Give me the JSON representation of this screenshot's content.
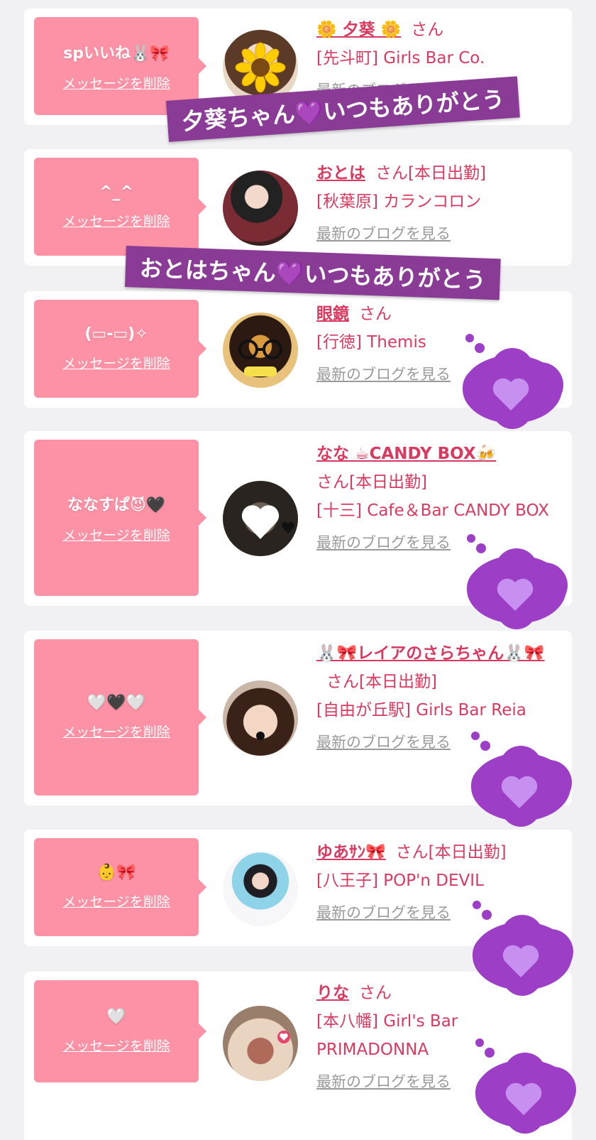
{
  "delete_label": "メッセージを削除",
  "san_label": "さん",
  "blog_label": "最新のブログを見る",
  "colors": {
    "bubble": "#fd92a6",
    "name": "#d83a60",
    "banner": "#8a3b96",
    "thought_cloud": "#9d3fc6",
    "heart": "#c78ff0"
  },
  "banners": [
    {
      "text": "夕葵ちゃん💜いつもありがとう"
    },
    {
      "text": "おとはちゃん💜いつもありがとう"
    }
  ],
  "items": [
    {
      "message": "spいいね🐰🎀",
      "name": "🌼 夕葵 🌼",
      "status": "",
      "shop": "[先斗町] Girls Bar Co.",
      "avatar_icon": "sunflower-sticker-icon"
    },
    {
      "message": "^_^",
      "name": "おとは",
      "status": "[本日出勤]",
      "shop": "[秋葉原] カランコロン",
      "avatar_icon": "portrait-photo-icon"
    },
    {
      "message": "(▭-▭)✧",
      "name": "眼鏡",
      "status": "",
      "shop": "[行徳] Themis",
      "avatar_icon": "glasses-photo-icon"
    },
    {
      "message": "ななすぱ😈🖤",
      "name": "なな ☕CANDY BOX🍻",
      "status": "[本日出勤]",
      "shop": "[十三] Cafe＆Bar CANDY BOX",
      "avatar_icon": "white-heart-sticker-icon"
    },
    {
      "message": "🤍🖤🤍",
      "name": "🐰🎀レイアのさらちゃん🐰🎀",
      "status": "[本日出勤]",
      "shop": "[自由が丘駅] Girls Bar Reia",
      "avatar_icon": "portrait-photo-icon"
    },
    {
      "message": "👶🎀",
      "name": "ゆあｻﾝ🎀",
      "status": "[本日出勤]",
      "shop": "[八王子] POP'n DEVIL",
      "avatar_icon": "costume-photo-icon"
    },
    {
      "message": "🤍",
      "name": "りな",
      "status": "",
      "shop": "[本八幡] Girl's Bar PRIMADONNA",
      "avatar_icon": "bar-interior-photo-icon"
    }
  ]
}
